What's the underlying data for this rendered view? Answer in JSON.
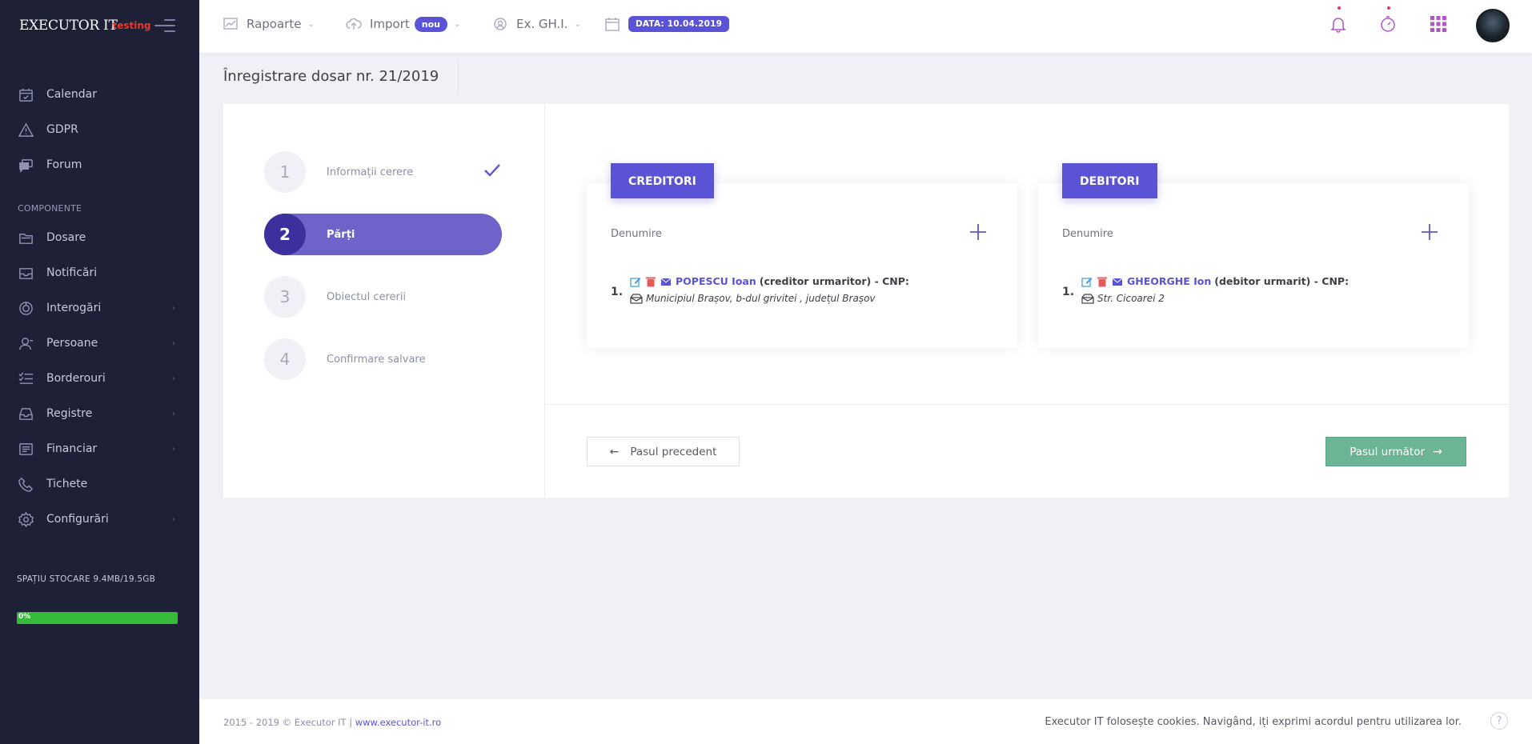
{
  "brand": {
    "name": "EXECUTOR IT",
    "tag": "testing"
  },
  "sidebar": {
    "items_top": [
      {
        "label": "Calendar",
        "icon": "calendar-icon"
      },
      {
        "label": "GDPR",
        "icon": "warning-icon"
      },
      {
        "label": "Forum",
        "icon": "forum-icon"
      }
    ],
    "section_label": "COMPONENTE",
    "items": [
      {
        "label": "Dosare",
        "icon": "folder-icon",
        "has_arrow": false
      },
      {
        "label": "Notificări",
        "icon": "notification-icon",
        "has_arrow": false
      },
      {
        "label": "Interogări",
        "icon": "query-icon",
        "has_arrow": true
      },
      {
        "label": "Persoane",
        "icon": "person-icon",
        "has_arrow": true
      },
      {
        "label": "Borderouri",
        "icon": "checklist-icon",
        "has_arrow": true
      },
      {
        "label": "Registre",
        "icon": "inbox-icon",
        "has_arrow": true
      },
      {
        "label": "Financiar",
        "icon": "finance-icon",
        "has_arrow": true
      },
      {
        "label": "Tichete",
        "icon": "phone-icon",
        "has_arrow": false
      },
      {
        "label": "Configurări",
        "icon": "gear-icon",
        "has_arrow": true
      }
    ],
    "arrow_glyph": "›",
    "storage_label": "SPAȚIU STOCARE 9.4MB/19.5GB",
    "storage_pct_label": "0%",
    "storage_fraction": 0.0005
  },
  "topbar": {
    "reports_label": "Rapoarte",
    "import_label": "Import",
    "import_badge": "nou",
    "ex_label": "Ex. GH.I.",
    "date_badge": "DATA: 10.04.2019",
    "chevron": "⌄"
  },
  "page": {
    "title": "Înregistrare dosar nr. 21/2019"
  },
  "steps": [
    {
      "num": "1",
      "label": "Informații cerere",
      "done": true
    },
    {
      "num": "2",
      "label": "Părți",
      "active": true
    },
    {
      "num": "3",
      "label": "Obiectul cererii"
    },
    {
      "num": "4",
      "label": "Confirmare salvare"
    }
  ],
  "creditori": {
    "title": "CREDITORI",
    "column": "Denumire",
    "entry_num": "1.",
    "name": "POPESCU Ioan",
    "role": "(creditor urmaritor) - CNP:",
    "address": "Municipiul Brașov, b-dul grivitei , județul Brașov"
  },
  "debitori": {
    "title": "DEBITORI",
    "column": "Denumire",
    "entry_num": "1.",
    "name": "GHEORGHE Ion",
    "role": "(debitor urmarit) - CNP:",
    "address": "Str. Cicoarei 2"
  },
  "buttons": {
    "prev": "Pasul precedent",
    "next": "Pasul următor"
  },
  "footer": {
    "copyright": "2015 - 2019 © Executor IT | ",
    "link": "www.executor-it.ro",
    "cookies": "Executor IT folosește cookies. Navigând, iți exprimi acordul pentru utilizarea lor.",
    "help": "?"
  },
  "colors": {
    "accent": "#5b53d6",
    "sidebar_bg": "#1e2036",
    "success": "#6bb494",
    "storage_bar": "#34bc38"
  }
}
